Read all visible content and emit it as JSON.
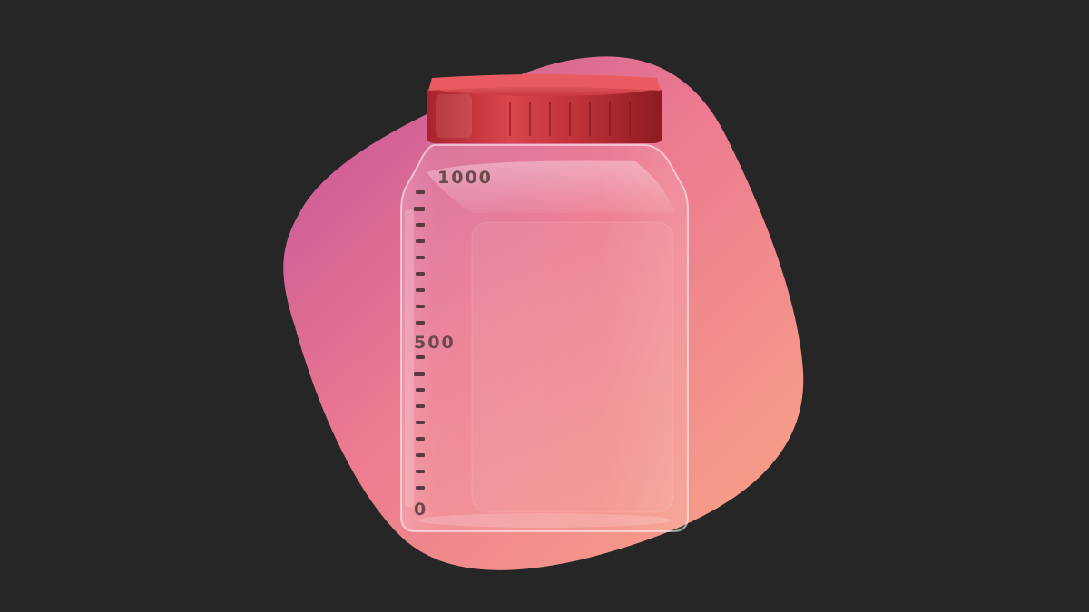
{
  "image": {
    "background_color": "#262626",
    "blob_colors": [
      "#c75a96",
      "#ee7f8e",
      "#f7a087"
    ],
    "cap_colors": [
      "#e2575c",
      "#b82b33",
      "#8e1c22"
    ]
  },
  "bottle": {
    "scale_labels": {
      "top": "1000",
      "middle": "500",
      "bottom": "0"
    },
    "icons": {
      "cap": "screw-cap-icon",
      "bottle": "jar-bottle-icon",
      "blob": "rounded-squircle-shape"
    }
  }
}
